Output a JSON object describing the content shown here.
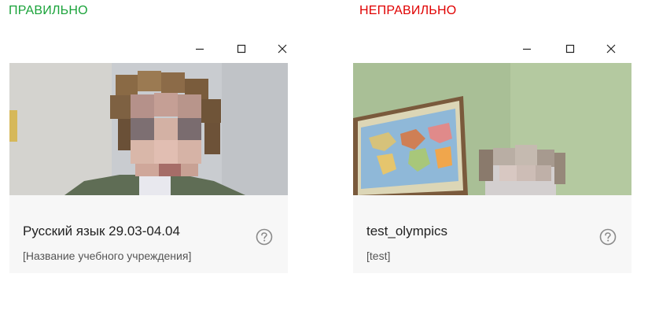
{
  "labels": {
    "correct": "ПРАВИЛЬНО",
    "wrong": "НЕПРАВИЛЬНО"
  },
  "colors": {
    "correct": "#1aa33a",
    "wrong": "#e00000"
  },
  "panels": [
    {
      "title": "Русский язык 29.03-04.04",
      "subtitle": "[Название учебного учреждения]",
      "window_controls": [
        "minimize-icon",
        "maximize-icon",
        "close-icon"
      ],
      "help_icon": "question-circle-icon"
    },
    {
      "title": "test_olympics",
      "subtitle": "[test]",
      "window_controls": [
        "minimize-icon",
        "maximize-icon",
        "close-icon"
      ],
      "help_icon": "question-circle-icon"
    }
  ]
}
